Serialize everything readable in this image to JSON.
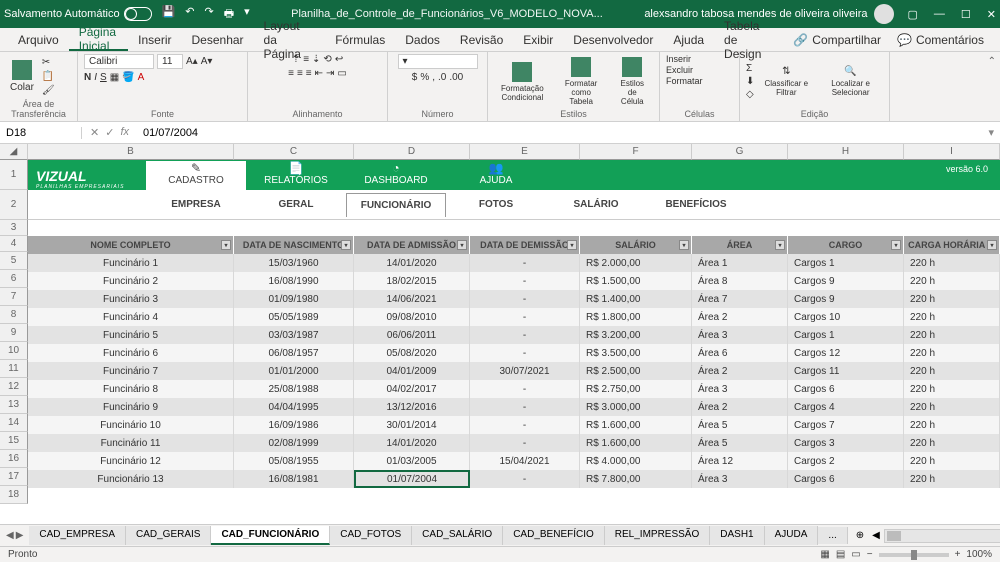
{
  "titlebar": {
    "autosave": "Salvamento Automático",
    "doctitle": "Planilha_de_Controle_de_Funcionários_V6_MODELO_NOVA...",
    "user": "alexsandro tabosa mendes de oliveira oliveira"
  },
  "menu": {
    "tabs": [
      "Arquivo",
      "Página Inicial",
      "Inserir",
      "Desenhar",
      "Layout da Página",
      "Fórmulas",
      "Dados",
      "Revisão",
      "Exibir",
      "Desenvolvedor",
      "Ajuda",
      "Tabela de Design"
    ],
    "active_index": 1,
    "share": "Compartilhar",
    "comments": "Comentários"
  },
  "ribbon": {
    "clipboard": {
      "paste": "Colar",
      "label": "Área de Transferência"
    },
    "font": {
      "name": "Calibri",
      "size": "11",
      "label": "Fonte"
    },
    "align": {
      "label": "Alinhamento"
    },
    "number": {
      "label": "Número"
    },
    "styles": {
      "cond": "Formatação Condicional",
      "table": "Formatar como Tabela",
      "cell": "Estilos de Célula",
      "label": "Estilos"
    },
    "cells": {
      "insert": "Inserir",
      "delete": "Excluir",
      "format": "Formatar",
      "label": "Células"
    },
    "edit": {
      "sort": "Classificar e Filtrar",
      "find": "Localizar e Selecionar",
      "label": "Edição"
    }
  },
  "fbar": {
    "cell": "D18",
    "value": "01/07/2004"
  },
  "colheaders": [
    "B",
    "C",
    "D",
    "E",
    "F",
    "G",
    "H",
    "I"
  ],
  "rowheaders": [
    "1",
    "2",
    "3",
    "4",
    "5",
    "6",
    "7",
    "8",
    "9",
    "10",
    "11",
    "12",
    "13",
    "14",
    "15",
    "16",
    "17",
    "18"
  ],
  "banner": {
    "logo": "VIZUAL",
    "logosub": "PLANILHAS EMPRESARIAIS",
    "tabs": [
      "CADASTRO",
      "RELATÓRIOS",
      "DASHBOARD",
      "AJUDA"
    ],
    "active": 0,
    "version": "versão 6.0",
    "subtabs": [
      "EMPRESA",
      "GERAL",
      "FUNCIONÁRIO",
      "FOTOS",
      "SALÁRIO",
      "BENEFÍCIOS"
    ],
    "sub_active": 2
  },
  "table": {
    "headers": [
      "NOME COMPLETO",
      "DATA DE NASCIMENTO",
      "DATA DE ADMISSÃO",
      "DATA DE DEMISSÃO",
      "SALÁRIO",
      "ÁREA",
      "CARGO",
      "CARGA HORÁRIA M"
    ],
    "rows": [
      {
        "nome": "Funcinário 1",
        "nasc": "15/03/1960",
        "adm": "14/01/2020",
        "dem": "-",
        "sal": "R$ 2.000,00",
        "area": "Área 1",
        "cargo": "Cargos 1",
        "carga": "220 h"
      },
      {
        "nome": "Funcinário 2",
        "nasc": "16/08/1990",
        "adm": "18/02/2015",
        "dem": "-",
        "sal": "R$ 1.500,00",
        "area": "Área 8",
        "cargo": "Cargos 9",
        "carga": "220 h"
      },
      {
        "nome": "Funcinário 3",
        "nasc": "01/09/1980",
        "adm": "14/06/2021",
        "dem": "-",
        "sal": "R$ 1.400,00",
        "area": "Área 7",
        "cargo": "Cargos 9",
        "carga": "220 h"
      },
      {
        "nome": "Funcinário 4",
        "nasc": "05/05/1989",
        "adm": "09/08/2010",
        "dem": "-",
        "sal": "R$ 1.800,00",
        "area": "Área 2",
        "cargo": "Cargos 10",
        "carga": "220 h"
      },
      {
        "nome": "Funcinário 5",
        "nasc": "03/03/1987",
        "adm": "06/06/2011",
        "dem": "-",
        "sal": "R$ 3.200,00",
        "area": "Área 3",
        "cargo": "Cargos 1",
        "carga": "220 h"
      },
      {
        "nome": "Funcinário 6",
        "nasc": "06/08/1957",
        "adm": "05/08/2020",
        "dem": "-",
        "sal": "R$ 3.500,00",
        "area": "Área 6",
        "cargo": "Cargos 12",
        "carga": "220 h"
      },
      {
        "nome": "Funcinário 7",
        "nasc": "01/01/2000",
        "adm": "04/01/2009",
        "dem": "30/07/2021",
        "sal": "R$ 2.500,00",
        "area": "Área 2",
        "cargo": "Cargos 11",
        "carga": "220 h"
      },
      {
        "nome": "Funcinário 8",
        "nasc": "25/08/1988",
        "adm": "04/02/2017",
        "dem": "-",
        "sal": "R$ 2.750,00",
        "area": "Área 3",
        "cargo": "Cargos 6",
        "carga": "220 h"
      },
      {
        "nome": "Funcinário 9",
        "nasc": "04/04/1995",
        "adm": "13/12/2016",
        "dem": "-",
        "sal": "R$ 3.000,00",
        "area": "Área 2",
        "cargo": "Cargos 4",
        "carga": "220 h"
      },
      {
        "nome": "Funcinário 10",
        "nasc": "16/09/1986",
        "adm": "30/01/2014",
        "dem": "-",
        "sal": "R$ 1.600,00",
        "area": "Área 5",
        "cargo": "Cargos 7",
        "carga": "220 h"
      },
      {
        "nome": "Funcinário 11",
        "nasc": "02/08/1999",
        "adm": "14/01/2020",
        "dem": "-",
        "sal": "R$ 1.600,00",
        "area": "Área 5",
        "cargo": "Cargos 3",
        "carga": "220 h"
      },
      {
        "nome": "Funcinário 12",
        "nasc": "05/08/1955",
        "adm": "01/03/2005",
        "dem": "15/04/2021",
        "sal": "R$ 4.000,00",
        "area": "Área 12",
        "cargo": "Cargos 2",
        "carga": "220 h"
      },
      {
        "nome": "Funcionário 13",
        "nasc": "16/08/1981",
        "adm": "01/07/2004",
        "dem": "-",
        "sal": "R$ 7.800,00",
        "area": "Área 3",
        "cargo": "Cargos 6",
        "carga": "220 h"
      }
    ]
  },
  "sheets": {
    "list": [
      "CAD_EMPRESA",
      "CAD_GERAIS",
      "CAD_FUNCIONÁRIO",
      "CAD_FOTOS",
      "CAD_SALÁRIO",
      "CAD_BENEFÍCIO",
      "REL_IMPRESSÃO",
      "DASH1",
      "AJUDA"
    ],
    "active": 2,
    "more": "...",
    "add": "⊕"
  },
  "status": {
    "ready": "Pronto",
    "zoom": "100%"
  }
}
